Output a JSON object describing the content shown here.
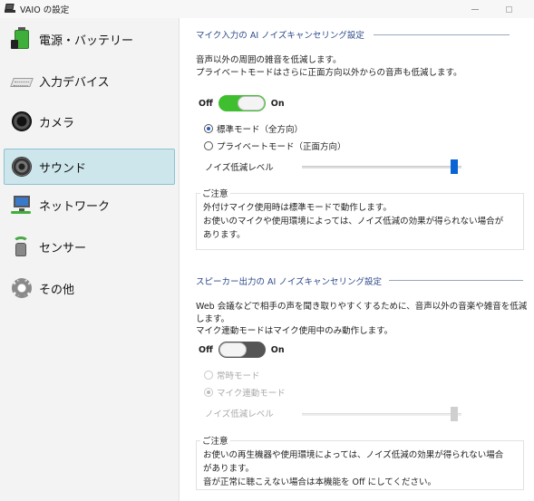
{
  "window": {
    "title": "VAIO の設定"
  },
  "sidebar": {
    "items": [
      {
        "label": "電源・バッテリー",
        "icon": "battery-icon"
      },
      {
        "label": "入力デバイス",
        "icon": "keyboard-icon"
      },
      {
        "label": "カメラ",
        "icon": "camera-icon"
      },
      {
        "label": "サウンド",
        "icon": "speaker-icon",
        "active": true
      },
      {
        "label": "ネットワーク",
        "icon": "network-icon"
      },
      {
        "label": "センサー",
        "icon": "sensor-icon"
      },
      {
        "label": "その他",
        "icon": "gear-icon"
      }
    ]
  },
  "mic_section": {
    "title": "マイク入力の AI ノイズキャンセリング設定",
    "desc_line1": "音声以外の周囲の雑音を低減します。",
    "desc_line2": "プライベートモードはさらに正面方向以外からの音声も低減します。",
    "toggle_off": "Off",
    "toggle_on": "On",
    "toggle_state": "on",
    "radio_standard": "標準モード（全方向）",
    "radio_private": "プライベートモード（正面方向）",
    "noise_level_label": "ノイズ低減レベル",
    "noise_level_value": 1.0,
    "notice_title": "ご注意",
    "notice_line1": "外付けマイク使用時は標準モードで動作します。",
    "notice_line2": "お使いのマイクや使用環境によっては、ノイズ低減の効果が得られない場合が",
    "notice_line3": "あります。"
  },
  "speaker_section": {
    "title": "スピーカー出力の AI ノイズキャンセリング設定",
    "desc_line1": "Web 会議などで相手の声を聞き取りやすくするために、音声以外の音楽や雑音を低減",
    "desc_line2": "します。",
    "desc_line3": "マイク連動モードはマイク使用中のみ動作します。",
    "toggle_off": "Off",
    "toggle_on": "On",
    "toggle_state": "off",
    "radio_always": "常時モード",
    "radio_mic_linked": "マイク連動モード",
    "noise_level_label": "ノイズ低減レベル",
    "noise_level_value": 1.0,
    "notice_title": "ご注意",
    "notice_line1": "お使いの再生機器や使用環境によっては、ノイズ低減の効果が得られない場合",
    "notice_line2": "があります。",
    "notice_line3": "音が正常に聴こえない場合は本機能を Off にしてください。"
  },
  "colors": {
    "accent": "#0a64d6",
    "toggle_on": "#3fbf2f",
    "section_title": "#2d4a8a",
    "active_nav_bg": "#cde6ec"
  }
}
